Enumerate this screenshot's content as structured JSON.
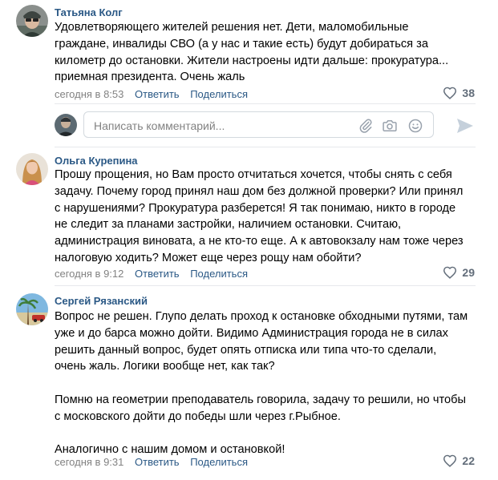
{
  "comments": [
    {
      "author": "Татьяна Колг",
      "lines": [
        "Удовлетворяющего жителей решения нет. Дети, маломобильные",
        "граждане, инвалиды СВО (а у нас и такие есть) будут добираться за",
        "километр до остановки. Жители настроены идти дальше: прокуратура...",
        "приемная президента. Очень жаль"
      ],
      "time": "сегодня в 8:53",
      "reply": "Ответить",
      "share": "Поделиться",
      "likes": "38"
    },
    {
      "author": "Ольга Курепина",
      "lines": [
        "Прошу прощения, но Вам просто отчитаться хочется, чтобы снять с себя",
        "задачу. Почему город принял наш дом без должной проверки? Или принял",
        "с нарушениями? Прокуратура разберется! Я так понимаю, никто в городе",
        "не следит за планами застройки, наличием остановки. Считаю,",
        "администрация виновата, а не кто-то еще. А к автовокзалу нам тоже через",
        "налоговую ходить? Может еще через рощу нам обойти?"
      ],
      "time": "сегодня в 9:12",
      "reply": "Ответить",
      "share": "Поделиться",
      "likes": "29"
    },
    {
      "author": "Сергей Рязанский",
      "lines": [
        "Вопрос не решен. Глупо делать проход к остановке обходными путями, там",
        "уже и до барса можно дойти. Видимо Администрация города не в силах",
        "решить данный вопрос, будет опять отписка или типа что-то сделали,",
        "очень жаль. Логики вообще нет, как так?",
        "",
        "Помню на геометрии преподаватель говорила, задачу то решили, но чтобы",
        "с московского дойти до победы шли через г.Рыбное.",
        "",
        "Аналогично с нашим домом и остановкой!"
      ],
      "time": "сегодня в 9:31",
      "reply": "Ответить",
      "share": "Поделиться",
      "likes": "22"
    }
  ],
  "composer": {
    "placeholder": "Написать комментарий...",
    "icons": [
      "paperclip-icon",
      "camera-icon",
      "emoji-icon",
      "send-icon"
    ]
  },
  "colors": {
    "link": "#2a5885",
    "meta": "#828282",
    "like": "#626d7a",
    "separator": "#e7e8ec"
  }
}
